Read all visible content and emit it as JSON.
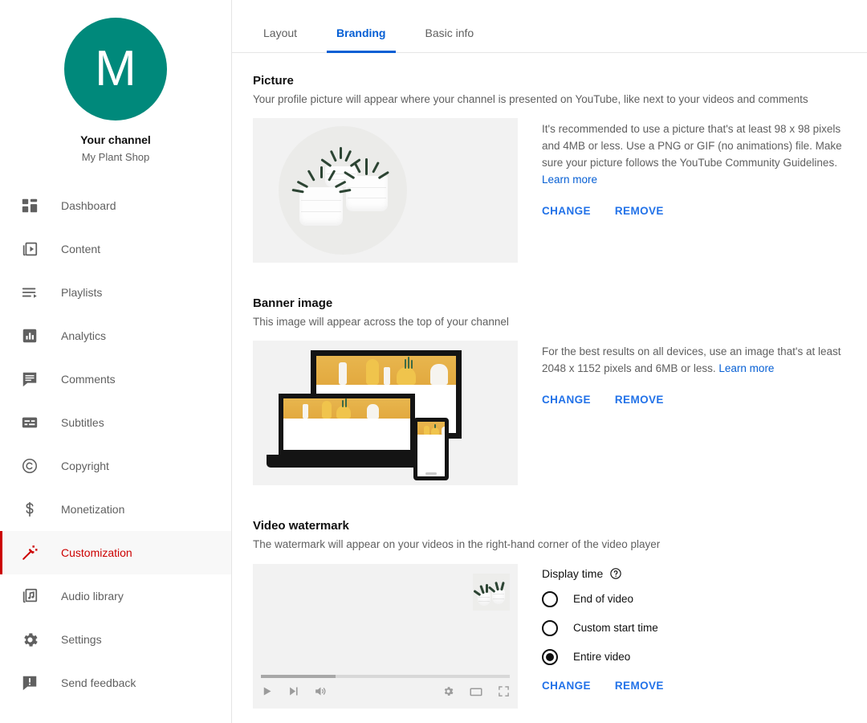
{
  "sidebar": {
    "avatar_initial": "M",
    "avatar_color": "#00897B",
    "channel_label": "Your channel",
    "channel_name": "My Plant Shop",
    "items": [
      {
        "label": "Dashboard",
        "icon": "dashboard-icon",
        "active": false
      },
      {
        "label": "Content",
        "icon": "content-icon",
        "active": false
      },
      {
        "label": "Playlists",
        "icon": "playlists-icon",
        "active": false
      },
      {
        "label": "Analytics",
        "icon": "analytics-icon",
        "active": false
      },
      {
        "label": "Comments",
        "icon": "comments-icon",
        "active": false
      },
      {
        "label": "Subtitles",
        "icon": "subtitles-icon",
        "active": false
      },
      {
        "label": "Copyright",
        "icon": "copyright-icon",
        "active": false
      },
      {
        "label": "Monetization",
        "icon": "dollar-icon",
        "active": false
      },
      {
        "label": "Customization",
        "icon": "magic-wand-icon",
        "active": true
      },
      {
        "label": "Audio library",
        "icon": "music-library-icon",
        "active": false
      },
      {
        "label": "Settings",
        "icon": "gear-icon",
        "active": false
      },
      {
        "label": "Send feedback",
        "icon": "feedback-icon",
        "active": false
      }
    ],
    "active_color": "#cc0000"
  },
  "tabs": {
    "active_color": "#065fd4",
    "items": [
      {
        "label": "Layout",
        "active": false
      },
      {
        "label": "Branding",
        "active": true
      },
      {
        "label": "Basic info",
        "active": false
      }
    ]
  },
  "sections": {
    "picture": {
      "title": "Picture",
      "description": "Your profile picture will appear where your channel is presented on YouTube, like next to your videos and comments",
      "help_text": "It's recommended to use a picture that's at least 98 x 98 pixels and 4MB or less. Use a PNG or GIF (no animations) file. Make sure your picture follows the YouTube Community Guidelines.",
      "learn_more": "Learn more",
      "change_label": "CHANGE",
      "remove_label": "REMOVE"
    },
    "banner": {
      "title": "Banner image",
      "description": "This image will appear across the top of your channel",
      "help_text": "For the best results on all devices, use an image that's at least 2048 x 1152 pixels and 6MB or less.",
      "learn_more": "Learn more",
      "change_label": "CHANGE",
      "remove_label": "REMOVE"
    },
    "watermark": {
      "title": "Video watermark",
      "description": "The watermark will appear on your videos in the right-hand corner of the video player",
      "display_time_title": "Display time",
      "options": [
        {
          "label": "End of video",
          "selected": false
        },
        {
          "label": "Custom start time",
          "selected": false
        },
        {
          "label": "Entire video",
          "selected": true
        }
      ],
      "change_label": "CHANGE",
      "remove_label": "REMOVE"
    }
  }
}
